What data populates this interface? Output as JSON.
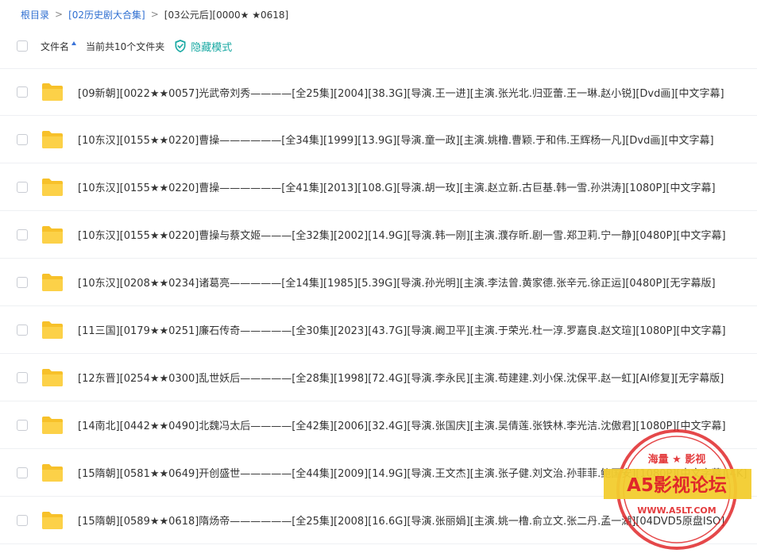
{
  "breadcrumb": {
    "root": "根目录",
    "level1": "[02历史剧大合集]",
    "current": "[03公元后][0000★ ★0618]"
  },
  "header": {
    "name_col": "文件名",
    "count_text": "当前共10个文件夹",
    "hide_mode": "隐藏模式"
  },
  "files": [
    "[09新朝][0022★★0057]光武帝刘秀————[全25集][2004][38.3G][导演.王一进][主演.张光北.归亚蕾.王一琳.赵小锐][Dvd画][中文字幕]",
    "[10东汉][0155★★0220]曹操——————[全34集][1999][13.9G][导演.童一政][主演.姚橹.曹颖.于和伟.王辉杨一凡][Dvd画][中文字幕]",
    "[10东汉][0155★★0220]曹操——————[全41集][2013][108.G][导演.胡一玫][主演.赵立新.古巨基.韩一雪.孙洪涛][1080P][中文字幕]",
    "[10东汉][0155★★0220]曹操与蔡文姬———[全32集][2002][14.9G][导演.韩一刚][主演.濮存昕.剧一雪.郑卫莉.宁一静][0480P][中文字幕]",
    "[10东汉][0208★★0234]诸葛亮—————[全14集][1985][5.39G][导演.孙光明][主演.李法曾.黄家德.张辛元.徐正运][0480P][无字幕版]",
    "[11三国][0179★★0251]廉石传奇—————[全30集][2023][43.7G][导演.阚卫平][主演.于荣光.杜一淳.罗嘉良.赵文瑄][1080P][中文字幕]",
    "[12东晋][0254★★0300]乱世妖后—————[全28集][1998][72.4G][导演.李永民][主演.苟建建.刘小保.沈保平.赵一虹][AI修复][无字幕版]",
    "[14南北][0442★★0490]北魏冯太后————[全42集][2006][32.4G][导演.张国庆][主演.吴倩莲.张铁林.李光洁.沈傲君][1080P][中文字幕]",
    "[15隋朝][0581★★0649]开创盛世—————[全44集][2009][14.9G][导演.王文杰][主演.张子健.刘文治.孙菲菲.鲍国安][1080P][中文字幕][4K]",
    "[15隋朝][0589★★0618]隋炀帝——————[全25集][2008][16.6G][导演.张丽娟][主演.姚一橹.俞立文.张二丹.孟一湖][04DVD5原盘ISO]"
  ],
  "watermark": {
    "top": "海量 ★ 影视",
    "main": "A5影视论坛",
    "url": "WWW.A5LT.COM"
  },
  "colors": {
    "link": "#2f6fd1",
    "accent_teal": "#19a9a3",
    "folder": "#f7c12a",
    "stamp_red": "#e0282a",
    "stamp_yellow": "#f2cc2e"
  }
}
